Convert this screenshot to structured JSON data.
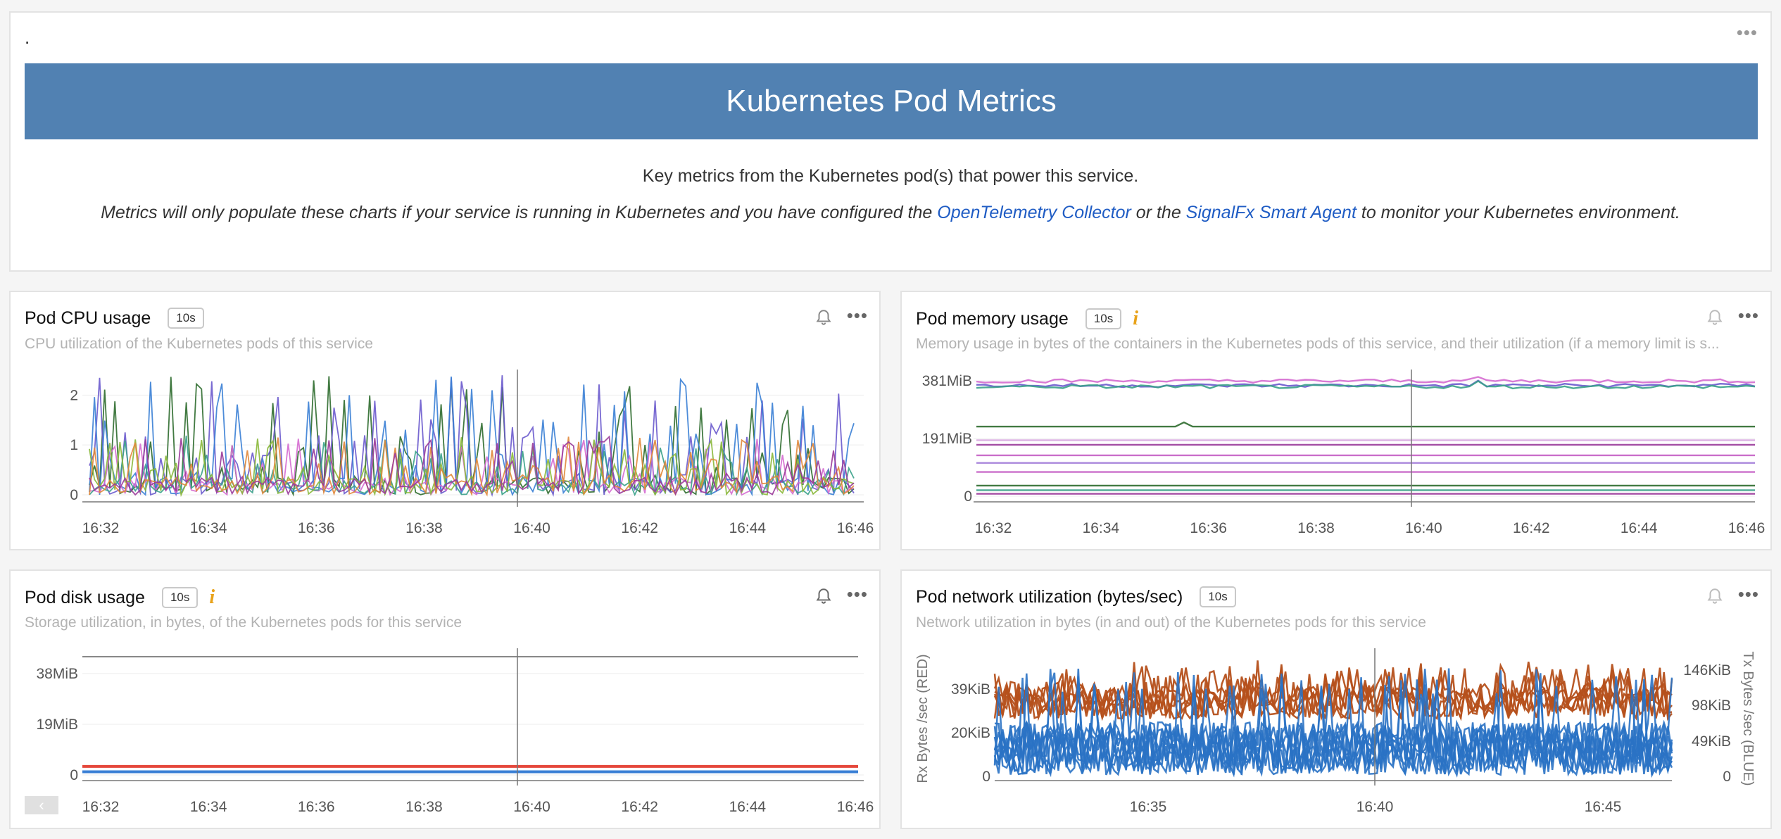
{
  "text_panel": {
    "dot": ".",
    "more_label": "•••",
    "banner_title": "Kubernetes Pod Metrics",
    "subtitle": "Key metrics from the Kubernetes pod(s) that power this service.",
    "note_before": "Metrics will only populate these charts if your service is running in Kubernetes and you have configured the ",
    "link_otel": "OpenTelemetry Collector",
    "note_middle": " or the ",
    "link_smart_agent": "SignalFx Smart Agent",
    "note_after": " to monitor your Kubernetes environment."
  },
  "common": {
    "more_label": "•••",
    "x_ticks": [
      "16:32",
      "16:34",
      "16:36",
      "16:38",
      "16:40",
      "16:42",
      "16:44",
      "16:46"
    ]
  },
  "cpu": {
    "title": "Pod CPU usage",
    "resolution": "10s",
    "description": "CPU utilization of the Kubernetes pods of this service"
  },
  "memory": {
    "title": "Pod memory usage",
    "resolution": "10s",
    "info": "i",
    "description": "Memory usage in bytes of the containers in the Kubernetes pods of this service, and their utilization (if a memory limit is s..."
  },
  "disk": {
    "title": "Pod disk usage",
    "resolution": "10s",
    "info": "i",
    "description": "Storage utilization, in bytes, of the Kubernetes pods for this service",
    "scroll_left": "‹"
  },
  "network": {
    "title": "Pod network utilization (bytes/sec)",
    "resolution": "10s",
    "description": "Network utilization in bytes (in and out) of the Kubernetes pods for this service"
  },
  "chart_data": [
    {
      "id": "cpu",
      "type": "line",
      "x": [
        "16:32",
        "16:34",
        "16:36",
        "16:38",
        "16:40",
        "16:42",
        "16:44",
        "16:46"
      ],
      "y_ticks": [
        "0",
        "1",
        "2"
      ],
      "ylim": [
        0,
        2.4
      ],
      "series_colors": [
        "#2e6b2e",
        "#6a5acd",
        "#3a7fd5",
        "#d56bd0",
        "#3aa18a",
        "#8ab83a",
        "#e0873a",
        "#9a3a9a"
      ],
      "series_count": 8,
      "marker_at": "16:40"
    },
    {
      "id": "memory",
      "type": "line",
      "x": [
        "16:32",
        "16:34",
        "16:36",
        "16:38",
        "16:40",
        "16:42",
        "16:44",
        "16:46"
      ],
      "y_ticks": [
        "0",
        "191MiB",
        "381MiB"
      ],
      "ylim": [
        0,
        400
      ],
      "series": [
        {
          "level": 381,
          "color": "#d56bd0"
        },
        {
          "level": 366,
          "color": "#6a5acd"
        },
        {
          "level": 362,
          "color": "#3aa18a"
        },
        {
          "level": 230,
          "color": "#2e6b2e"
        },
        {
          "level": 185,
          "color": "#d8a8e0"
        },
        {
          "level": 170,
          "color": "#9a3a9a"
        },
        {
          "level": 135,
          "color": "#c45fc4"
        },
        {
          "level": 110,
          "color": "#a07ad8"
        },
        {
          "level": 80,
          "color": "#c45fc4"
        },
        {
          "level": 35,
          "color": "#2e6b2e"
        },
        {
          "level": 20,
          "color": "#3aa18a"
        },
        {
          "level": 8,
          "color": "#9a3a9a"
        }
      ],
      "marker_at": "16:40"
    },
    {
      "id": "disk",
      "type": "line",
      "x": [
        "16:32",
        "16:34",
        "16:36",
        "16:38",
        "16:40",
        "16:42",
        "16:44",
        "16:46"
      ],
      "y_ticks": [
        "0",
        "19MiB",
        "38MiB"
      ],
      "ylim": [
        0,
        48
      ],
      "series": [
        {
          "level": 3.2,
          "color": "#e5473b"
        },
        {
          "level": 1.2,
          "color": "#3a7fd5"
        }
      ],
      "marker_at": "16:40"
    },
    {
      "id": "network",
      "type": "line",
      "x": [
        "16:35",
        "16:40",
        "16:45"
      ],
      "y_left_label": "Rx Bytes /sec (RED)",
      "y_left_ticks": [
        "0",
        "20KiB",
        "39KiB"
      ],
      "y_right_label": "Tx Bytes /sec (BLUE)",
      "y_right_ticks": [
        "0",
        "49KiB",
        "98KiB",
        "146KiB"
      ],
      "series": [
        {
          "name": "Rx",
          "color": "#b5501b"
        },
        {
          "name": "Tx",
          "color": "#2a72c4"
        }
      ],
      "marker_at": "16:40"
    }
  ]
}
